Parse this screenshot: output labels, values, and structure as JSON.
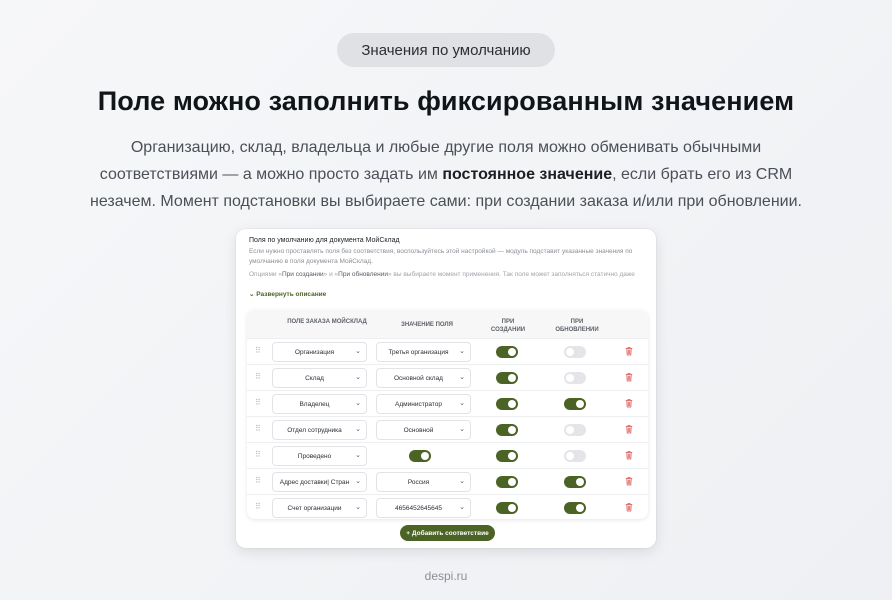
{
  "badge": "Значения по умолчанию",
  "headline": "Поле можно заполнить фиксированным значением",
  "lede": {
    "line1": "Организацию, склад, владельца и любые другие поля можно обменивать обычными",
    "line2_a": "соответствиями — а можно просто задать им ",
    "line2_bold": "постоянное значение",
    "line2_b": ", если брать его из CRM",
    "line3": "незачем. Момент подстановки вы выбираете сами: при создании заказа и/или при обновлении."
  },
  "card": {
    "title": "Поля по умолчанию для документа МойСклад",
    "desc": "Если нужно проставлять поля без соответствия, воспользуйтесь этой настройкой — модуль подставит указанные значения по умолчанию в поля документа МойСклад.",
    "hint_a": "Опциями «",
    "hint_b1": "При создании",
    "hint_c": "» и «",
    "hint_b2": "При обновлении",
    "hint_d": "» вы выбираете момент применения. Так поле может заполняться статично даже",
    "expand_label": "Развернуть описание",
    "add_button": "+ Добавить соответствие"
  },
  "table": {
    "headers": {
      "field": "ПОЛЕ ЗАКАЗА МОЙСКЛАД",
      "value": "ЗНАЧЕНИЕ ПОЛЯ",
      "on_create": "ПРИ СОЗДАНИИ",
      "on_update": "ПРИ ОБНОВЛЕНИИ"
    },
    "rows": [
      {
        "field": "Организация",
        "value": "Третья организация",
        "value_type": "select",
        "on_create": true,
        "on_update": false
      },
      {
        "field": "Склад",
        "value": "Основной склад",
        "value_type": "select",
        "on_create": true,
        "on_update": false
      },
      {
        "field": "Владелец",
        "value": "Администратор",
        "value_type": "select",
        "on_create": true,
        "on_update": true
      },
      {
        "field": "Отдел сотрудника",
        "value": "Основной",
        "value_type": "select",
        "on_create": true,
        "on_update": false
      },
      {
        "field": "Проведено",
        "value": "",
        "value_type": "toggle",
        "value_on": true,
        "on_create": true,
        "on_update": false
      },
      {
        "field": "Адрес доставки| Стран",
        "value": "Россия",
        "value_type": "select",
        "on_create": true,
        "on_update": true
      },
      {
        "field": "Счет организации",
        "value": "4656452645645",
        "value_type": "select",
        "on_create": true,
        "on_update": true
      }
    ]
  },
  "footer": "despi.ru",
  "colors": {
    "accent": "#4c6326",
    "toggle_off": "#e4e5e8",
    "trash": "#d9534f"
  }
}
